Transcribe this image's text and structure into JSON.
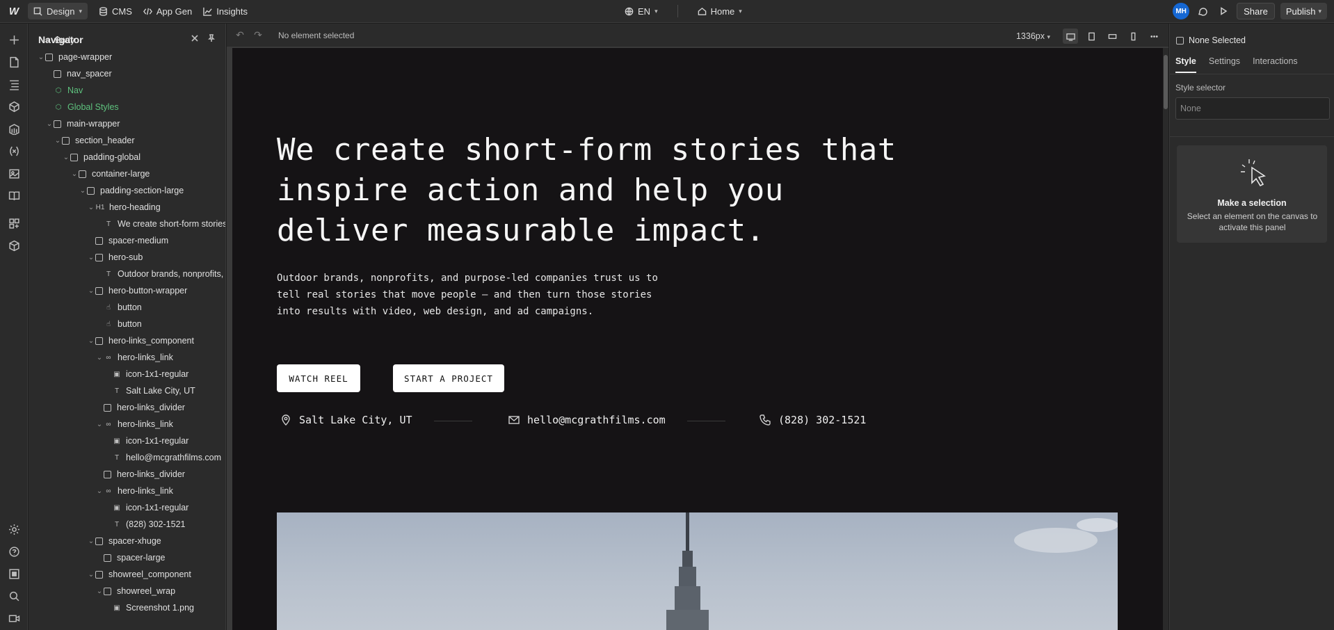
{
  "topbar": {
    "design_label": "Design",
    "cms_label": "CMS",
    "appgen_label": "App Gen",
    "insights_label": "Insights",
    "locale_label": "EN",
    "page_label": "Home",
    "avatar_initials": "MH",
    "share_label": "Share",
    "publish_label": "Publish"
  },
  "navigator": {
    "title": "Navigator",
    "items": [
      {
        "label": "Body",
        "icon": "body-icon"
      },
      {
        "label": "page-wrapper",
        "icon": "box"
      },
      {
        "label": "nav_spacer",
        "icon": "box"
      },
      {
        "label": "Nav",
        "icon": "component-icon"
      },
      {
        "label": "Global Styles",
        "icon": "component-icon"
      },
      {
        "label": "main-wrapper",
        "icon": "box"
      },
      {
        "label": "section_header",
        "icon": "box"
      },
      {
        "label": "padding-global",
        "icon": "box"
      },
      {
        "label": "container-large",
        "icon": "box"
      },
      {
        "label": "padding-section-large",
        "icon": "box"
      },
      {
        "label": "hero-heading",
        "icon": "heading-icon",
        "glyph": "H1"
      },
      {
        "label": "We create short-form stories",
        "icon": "text-icon",
        "glyph": "T"
      },
      {
        "label": "spacer-medium",
        "icon": "box"
      },
      {
        "label": "hero-sub",
        "icon": "box"
      },
      {
        "label": "Outdoor brands, nonprofits,",
        "icon": "text-icon",
        "glyph": "T"
      },
      {
        "label": "hero-button-wrapper",
        "icon": "box"
      },
      {
        "label": "button",
        "icon": "button-icon"
      },
      {
        "label": "button",
        "icon": "button-icon"
      },
      {
        "label": "hero-links_component",
        "icon": "box"
      },
      {
        "label": "hero-links_link",
        "icon": "link-icon"
      },
      {
        "label": "icon-1x1-regular",
        "icon": "image-icon"
      },
      {
        "label": "Salt Lake City, UT",
        "icon": "text-icon",
        "glyph": "T"
      },
      {
        "label": "hero-links_divider",
        "icon": "box"
      },
      {
        "label": "hero-links_link",
        "icon": "link-icon"
      },
      {
        "label": "icon-1x1-regular",
        "icon": "image-icon"
      },
      {
        "label": "hello@mcgrathfilms.com",
        "icon": "text-icon",
        "glyph": "T"
      },
      {
        "label": "hero-links_divider",
        "icon": "box"
      },
      {
        "label": "hero-links_link",
        "icon": "link-icon"
      },
      {
        "label": "icon-1x1-regular",
        "icon": "image-icon"
      },
      {
        "label": "(828) 302-1521",
        "icon": "text-icon",
        "glyph": "T"
      },
      {
        "label": "spacer-xhuge",
        "icon": "box"
      },
      {
        "label": "spacer-large",
        "icon": "box"
      },
      {
        "label": "showreel_component",
        "icon": "box"
      },
      {
        "label": "showreel_wrap",
        "icon": "box"
      },
      {
        "label": "Screenshot 1.png",
        "icon": "image-icon"
      }
    ]
  },
  "canvas_toolbar": {
    "status": "No element selected",
    "breakpoint": "1336px"
  },
  "page": {
    "hero_heading": "We create short-form stories that inspire action and help you deliver measurable impact.",
    "hero_sub": "Outdoor brands, nonprofits, and purpose-led companies trust us to tell real stories that move people — and then turn those stories into results with video, web design, and ad campaigns.",
    "button_reel": "WATCH REEL",
    "button_project": "START A PROJECT",
    "link_location": "Salt Lake City, UT",
    "link_email": "hello@mcgrathfilms.com",
    "link_phone": "(828) 302-1521"
  },
  "rightpanel": {
    "none_selected": "None Selected",
    "tabs": [
      "Style",
      "Settings",
      "Interactions"
    ],
    "style_selector_label": "Style selector",
    "style_selector_placeholder": "None",
    "card_title": "Make a selection",
    "card_desc": "Select an element on the canvas to activate this panel"
  }
}
